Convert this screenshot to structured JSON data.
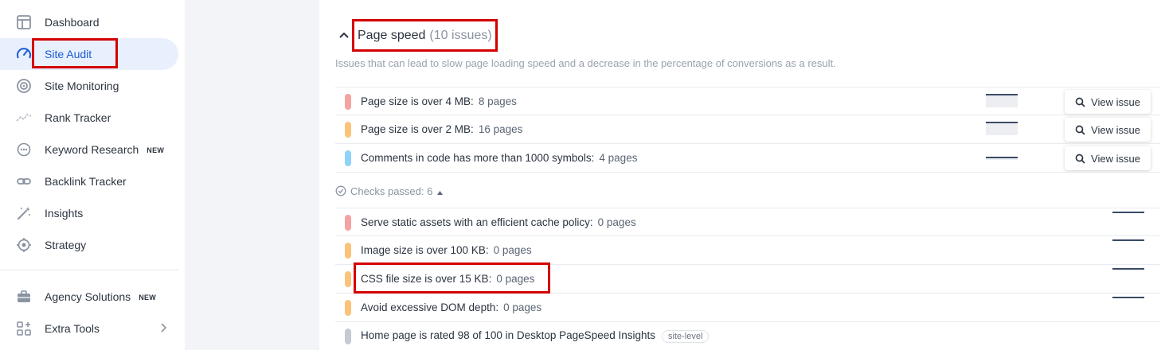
{
  "sidebar": {
    "items": [
      {
        "label": "Dashboard",
        "icon": "dashboard-icon",
        "badge": ""
      },
      {
        "label": "Site Audit",
        "icon": "speedometer-icon",
        "badge": "",
        "active": true
      },
      {
        "label": "Site Monitoring",
        "icon": "monitoring-icon",
        "badge": ""
      },
      {
        "label": "Rank Tracker",
        "icon": "rank-tracker-icon",
        "badge": ""
      },
      {
        "label": "Keyword Research",
        "icon": "keyword-icon",
        "badge": "NEW"
      },
      {
        "label": "Backlink Tracker",
        "icon": "link-icon",
        "badge": ""
      },
      {
        "label": "Insights",
        "icon": "magic-wand-icon",
        "badge": ""
      },
      {
        "label": "Strategy",
        "icon": "target-icon",
        "badge": ""
      }
    ],
    "bottom_items": [
      {
        "label": "Agency Solutions",
        "icon": "briefcase-icon",
        "badge": "NEW"
      },
      {
        "label": "Extra Tools",
        "icon": "grid-plus-icon",
        "badge": ""
      }
    ]
  },
  "section": {
    "title": "Page speed",
    "count": "(10 issues)",
    "description": "Issues that can lead to slow page loading speed and a decrease in the percentage of conversions as a result."
  },
  "issues": [
    {
      "title": "Page size is over 4 MB:",
      "count": "8 pages",
      "color": "#f4a3a3",
      "button": "View issue"
    },
    {
      "title": "Page size is over 2 MB:",
      "count": "16 pages",
      "color": "#f9c47a",
      "button": "View issue"
    },
    {
      "title": "Comments in code has more than 1000 symbols:",
      "count": "4 pages",
      "color": "#8fd3f8",
      "button": "View issue"
    }
  ],
  "checks_passed": {
    "label": "Checks passed: 6"
  },
  "passed": [
    {
      "title": "Serve static assets with an efficient cache policy:",
      "count": "0 pages",
      "color": "#f4a3a3"
    },
    {
      "title": "Image size is over 100 KB:",
      "count": "0 pages",
      "color": "#f9c47a"
    },
    {
      "title": "CSS file size is over 15 KB:",
      "count": "0 pages",
      "color": "#f9c47a"
    },
    {
      "title": "Avoid excessive DOM depth:",
      "count": "0 pages",
      "color": "#f9c47a"
    },
    {
      "title": "Home page is rated 98 of 100 in Desktop PageSpeed Insights",
      "count": "",
      "color": "#c5cad3",
      "tag": "site-level"
    }
  ],
  "colors": {
    "accent": "#1a5bd6",
    "active_bg": "#e9f0fd",
    "highlight": "#d40000"
  }
}
